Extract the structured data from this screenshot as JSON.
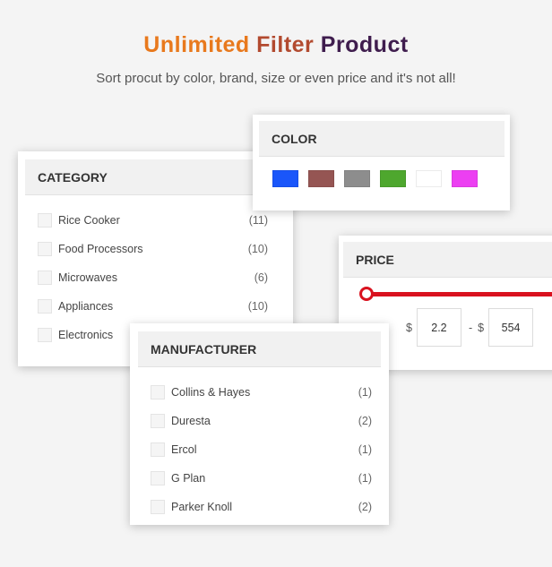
{
  "hero": {
    "title_word1": "Unlimited",
    "title_word2": "Filter",
    "title_word3": "Product",
    "subtitle": "Sort procut by color, brand, size or even price and it's not all!"
  },
  "colors": {
    "title_orange": "#e8791d",
    "title_rust": "#b24a2f",
    "title_purple": "#3f1d4e",
    "slider_red": "#d9121f"
  },
  "category": {
    "title": "CATEGORY",
    "items": [
      {
        "label": "Rice Cooker",
        "count": "(11)"
      },
      {
        "label": "Food Processors",
        "count": "(10)"
      },
      {
        "label": "Microwaves",
        "count": "(6)"
      },
      {
        "label": "Appliances",
        "count": "(10)"
      },
      {
        "label": "Electronics",
        "count": ""
      }
    ]
  },
  "color_filter": {
    "title": "COLOR",
    "swatches": [
      "#1a56fa",
      "#955553",
      "#8d8d8d",
      "#4ea72e",
      "#ffffff",
      "#ec3ff2"
    ]
  },
  "price": {
    "title": "PRICE",
    "currency": "$",
    "separator": "-",
    "min": "2.2",
    "max": "554"
  },
  "manufacturer": {
    "title": "MANUFACTURER",
    "items": [
      {
        "label": "Collins & Hayes",
        "count": "(1)"
      },
      {
        "label": "Duresta",
        "count": "(2)"
      },
      {
        "label": "Ercol",
        "count": "(1)"
      },
      {
        "label": "G Plan",
        "count": "(1)"
      },
      {
        "label": "Parker Knoll",
        "count": "(2)"
      }
    ]
  }
}
